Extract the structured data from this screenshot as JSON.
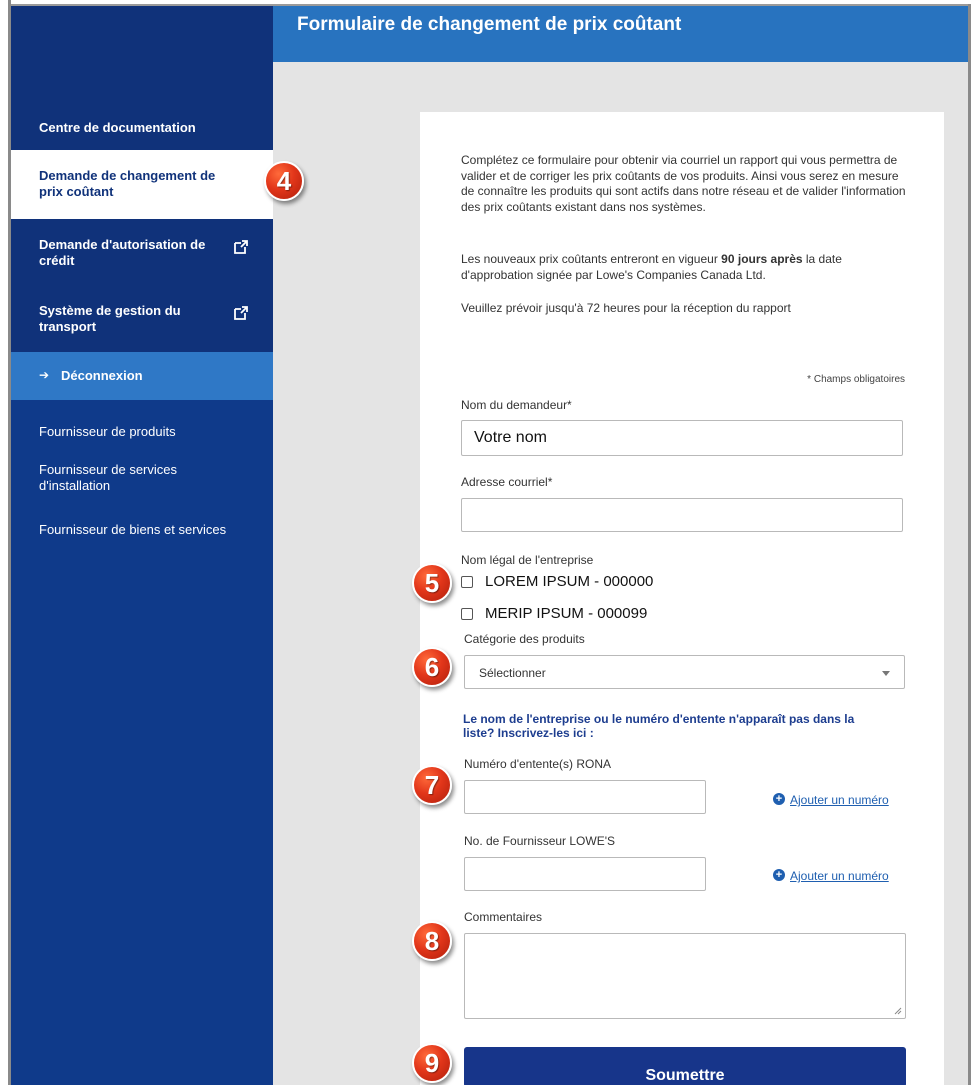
{
  "header": {
    "title": "Formulaire de changement de prix coûtant"
  },
  "sidebar": {
    "items": [
      {
        "label": "Centre de documentation"
      },
      {
        "label": "Demande de changement de prix coûtant"
      },
      {
        "label": "Demande d'autorisation de crédit",
        "icon": "external-link-icon"
      },
      {
        "label": "Système de gestion du transport",
        "icon": "external-link-icon"
      }
    ],
    "logout": {
      "label": "Déconnexion",
      "icon": "sign-out-icon"
    },
    "links": [
      {
        "label": "Fournisseur de produits"
      },
      {
        "label": "Fournisseur de services d'installation"
      },
      {
        "label": "Fournisseur de biens et services"
      }
    ]
  },
  "intro": {
    "p1": "Complétez ce formulaire pour obtenir via courriel un rapport qui vous permettra de valider et de corriger les prix coûtants de vos produits. Ainsi vous serez en mesure de connaître les produits qui sont actifs dans notre réseau et de valider l'information des prix coûtants existant dans nos systèmes.",
    "p2_before": "Les nouveaux prix coûtants entreront en vigueur ",
    "p2_bold": "90 jours après",
    "p2_after": " la date d'approbation signée par Lowe's Companies Canada Ltd.",
    "p3": "Veuillez prévoir jusqu'à 72 heures pour la réception du rapport"
  },
  "form": {
    "required_note": "* Champs obligatoires",
    "requester": {
      "label": "Nom du demandeur*",
      "value": "Votre nom"
    },
    "email": {
      "label": "Adresse courriel*",
      "value": ""
    },
    "company": {
      "label": "Nom légal de l'entreprise",
      "options": [
        {
          "label": "LOREM IPSUM - 000000",
          "checked": false
        },
        {
          "label": "MERIP IPSUM - 000099",
          "checked": false
        }
      ]
    },
    "category": {
      "label": "Catégorie des produits",
      "selected": "Sélectionner"
    },
    "missing_note": "Le nom de l'entreprise ou le numéro d'entente n'apparaît pas dans la liste? Inscrivez-les ici :",
    "rona": {
      "label": "Numéro d'entente(s) RONA",
      "value": "",
      "add_label": "Ajouter un numéro"
    },
    "lowes": {
      "label": "No. de Fournisseur LOWE'S",
      "value": "",
      "add_label": "Ajouter un numéro"
    },
    "comments": {
      "label": "Commentaires",
      "value": ""
    },
    "submit_label": "Soumettre"
  },
  "steps": [
    "4",
    "5",
    "6",
    "7",
    "8",
    "9"
  ],
  "colors": {
    "sidebar": "#10327a",
    "sidebar_lower": "#0f3a8a",
    "header": "#2873bf",
    "logout": "#2f78c6",
    "submit": "#17358a",
    "badge": "#e2361a",
    "link": "#1f5fb0"
  }
}
